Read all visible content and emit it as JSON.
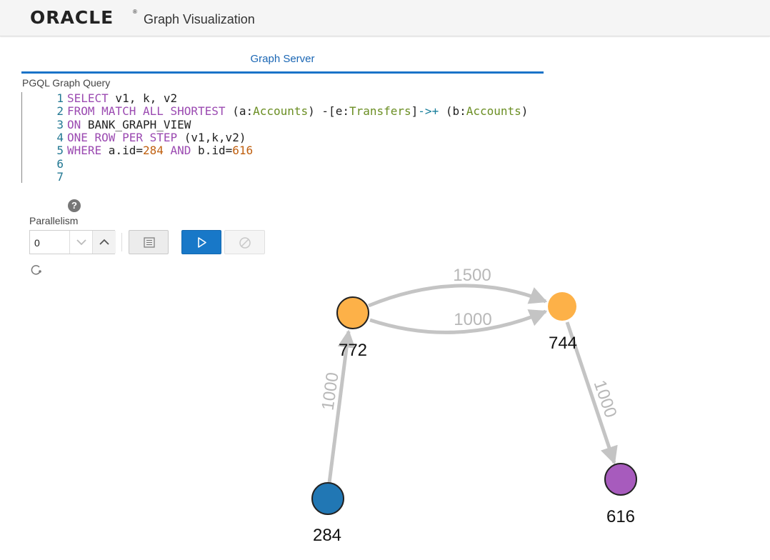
{
  "header": {
    "brand": "ORACLE",
    "brand_mark": "®",
    "title": "Graph Visualization"
  },
  "tabs": [
    {
      "label": "Graph Server",
      "active": true
    }
  ],
  "query": {
    "label": "PGQL Graph Query",
    "lines": [
      {
        "n": "1",
        "tokens": [
          {
            "t": "SELECT",
            "c": "kw"
          },
          {
            "t": " v1, k, v2",
            "c": ""
          }
        ]
      },
      {
        "n": "2",
        "tokens": [
          {
            "t": "FROM MATCH ALL SHORTEST",
            "c": "kw"
          },
          {
            "t": " (a:",
            "c": ""
          },
          {
            "t": "Accounts",
            "c": "ty"
          },
          {
            "t": ") -[e:",
            "c": ""
          },
          {
            "t": "Transfers",
            "c": "ty"
          },
          {
            "t": "]",
            "c": ""
          },
          {
            "t": "->+",
            "c": "op"
          },
          {
            "t": " (b:",
            "c": ""
          },
          {
            "t": "Accounts",
            "c": "ty"
          },
          {
            "t": ")",
            "c": ""
          }
        ]
      },
      {
        "n": "3",
        "tokens": [
          {
            "t": "ON",
            "c": "kw"
          },
          {
            "t": " BANK_GRAPH_VIEW",
            "c": ""
          }
        ]
      },
      {
        "n": "4",
        "tokens": [
          {
            "t": "ONE ROW PER STEP",
            "c": "kw"
          },
          {
            "t": " (v1,k,v2)",
            "c": ""
          }
        ]
      },
      {
        "n": "5",
        "tokens": [
          {
            "t": "WHERE",
            "c": "kw"
          },
          {
            "t": " a.id=",
            "c": ""
          },
          {
            "t": "284",
            "c": "num"
          },
          {
            "t": " ",
            "c": ""
          },
          {
            "t": "AND",
            "c": "kw"
          },
          {
            "t": " b.id=",
            "c": ""
          },
          {
            "t": "616",
            "c": "num"
          }
        ]
      },
      {
        "n": "6",
        "tokens": []
      },
      {
        "n": "7",
        "tokens": []
      }
    ]
  },
  "controls": {
    "help_glyph": "?",
    "parallelism_label": "Parallelism",
    "parallelism_value": "0",
    "icons": [
      "chevron-down-icon",
      "chevron-up-icon",
      "list-icon",
      "play-icon",
      "cancel-icon",
      "refresh-icon"
    ]
  },
  "colors": {
    "accent": "#1878c8",
    "node_orange": "#fdb148",
    "node_blue": "#2177b4",
    "node_purple": "#a75bbd",
    "edge": "#c4c4c4"
  },
  "graph": {
    "nodes": [
      {
        "id": "772",
        "label": "772",
        "color": "#fdb148"
      },
      {
        "id": "744",
        "label": "744",
        "color": "#fdb148"
      },
      {
        "id": "284",
        "label": "284",
        "color": "#2177b4"
      },
      {
        "id": "616",
        "label": "616",
        "color": "#a75bbd"
      }
    ],
    "edges": [
      {
        "from": "772",
        "to": "744",
        "label": "1500"
      },
      {
        "from": "772",
        "to": "744",
        "label": "1000"
      },
      {
        "from": "284",
        "to": "772",
        "label": "1000"
      },
      {
        "from": "744",
        "to": "616",
        "label": "1000"
      }
    ]
  }
}
